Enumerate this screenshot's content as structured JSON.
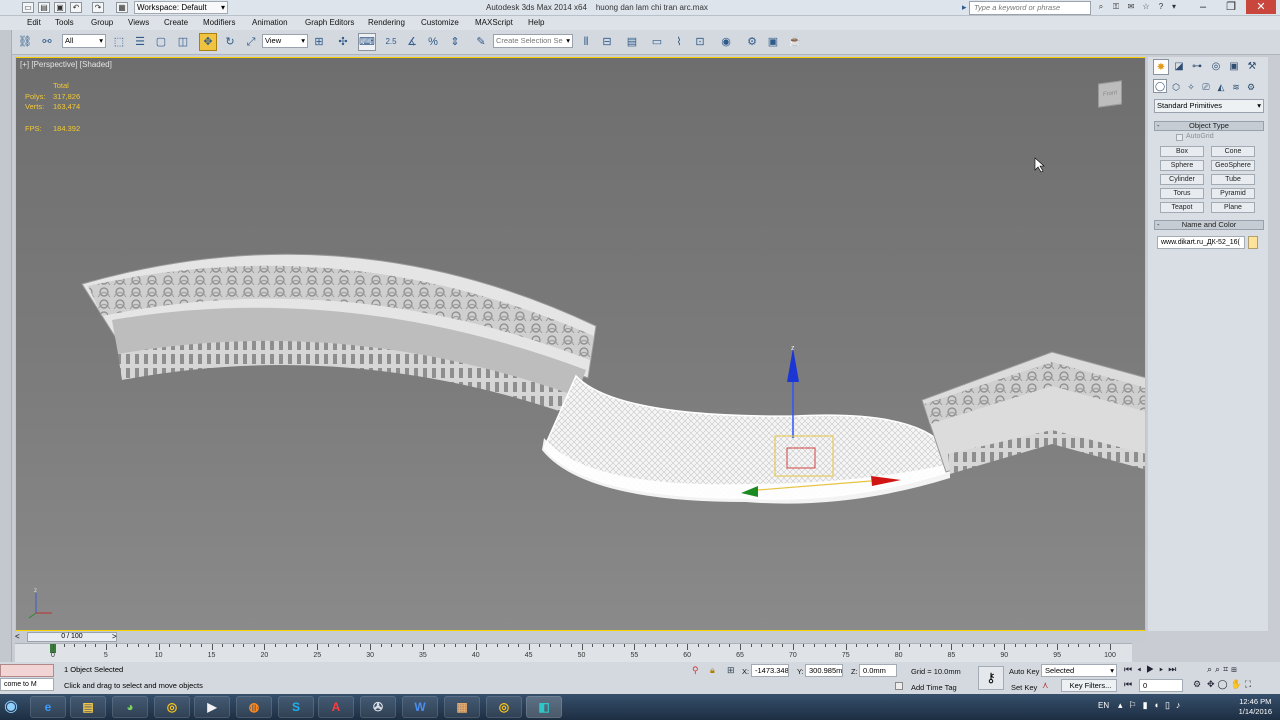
{
  "titlebar": {
    "app_title": "Autodesk 3ds Max  2014 x64",
    "file_name": "huong dan lam chi tran arc.max",
    "workspace": "Workspace: Default",
    "search_placeholder": "Type a keyword or phrase"
  },
  "menu": [
    "Edit",
    "Tools",
    "Group",
    "Views",
    "Create",
    "Modifiers",
    "Animation",
    "Graph Editors",
    "Rendering",
    "Customize",
    "MAXScript",
    "Help"
  ],
  "toolbar": {
    "filter": "All",
    "ref_coord": "View",
    "snap_label": "2.5",
    "selection_set": "Create Selection Se"
  },
  "viewport": {
    "label": "[+] [Perspective] [Shaded]",
    "stats": {
      "total_label": "Total",
      "polys_label": "Polys:",
      "polys_value": "317,826",
      "verts_label": "Verts:",
      "verts_value": "163,474",
      "fps_label": "FPS:",
      "fps_value": "184.392"
    },
    "viewcube": "Front"
  },
  "command_panel": {
    "category": "Standard Primitives",
    "object_type_title": "Object Type",
    "autogrid": "AutoGrid",
    "buttons": [
      "Box",
      "Cone",
      "Sphere",
      "GeoSphere",
      "Cylinder",
      "Tube",
      "Torus",
      "Pyramid",
      "Teapot",
      "Plane"
    ],
    "name_color_title": "Name and Color",
    "object_name": "www.dikart.ru_ДК-52_16(",
    "color": "#ffe39a"
  },
  "timeline": {
    "frame": "0 / 100",
    "ticks": [
      "0",
      "5",
      "10",
      "15",
      "20",
      "25",
      "30",
      "35",
      "40",
      "45",
      "50",
      "55",
      "60",
      "65",
      "70",
      "75",
      "80",
      "85",
      "90",
      "95",
      "100"
    ]
  },
  "status": {
    "listener": "come to M",
    "selection": "1 Object Selected",
    "prompt": "Click and drag to select and move objects",
    "x_label": "X:",
    "x": "-1473.348",
    "y_label": "Y:",
    "y": "300.985m",
    "z_label": "Z:",
    "z": "0.0mm",
    "grid": "Grid = 10.0mm",
    "add_time_tag": "Add Time Tag",
    "auto_key": "Auto Key",
    "set_key": "Set Key",
    "key_mode": "Selected",
    "key_filters": "Key Filters...",
    "current_frame": "0"
  },
  "taskbar": {
    "lang": "EN",
    "time": "12:46 PM",
    "date": "1/14/2016"
  }
}
